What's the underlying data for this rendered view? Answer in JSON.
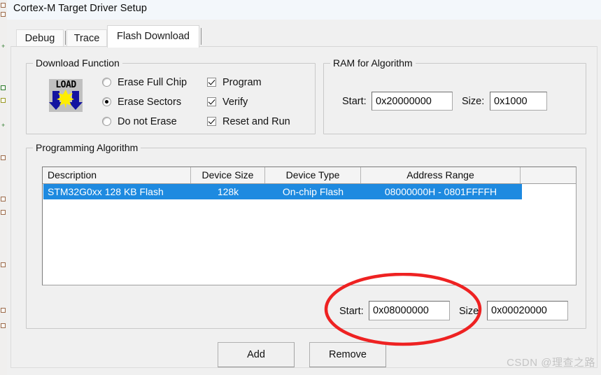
{
  "window": {
    "title": "Cortex-M Target Driver Setup"
  },
  "tabs": [
    {
      "label": "Debug",
      "active": false
    },
    {
      "label": "Trace",
      "active": false
    },
    {
      "label": "Flash Download",
      "active": true
    }
  ],
  "download_function": {
    "group_title": "Download Function",
    "icon_name": "load-icon",
    "icon_text": "LOAD",
    "radios": [
      {
        "label": "Erase Full Chip",
        "checked": false
      },
      {
        "label": "Erase Sectors",
        "checked": true
      },
      {
        "label": "Do not Erase",
        "checked": false
      }
    ],
    "checkboxes": [
      {
        "label": "Program",
        "checked": true
      },
      {
        "label": "Verify",
        "checked": true
      },
      {
        "label": "Reset and Run",
        "checked": true
      }
    ]
  },
  "ram_for_algorithm": {
    "group_title": "RAM for Algorithm",
    "start_label": "Start:",
    "start_value": "0x20000000",
    "size_label": "Size:",
    "size_value": "0x1000"
  },
  "programming_algorithm": {
    "group_title": "Programming Algorithm",
    "columns": [
      "Description",
      "Device Size",
      "Device Type",
      "Address Range",
      ""
    ],
    "rows": [
      {
        "description": "STM32G0xx 128 KB Flash",
        "device_size": "128k",
        "device_type": "On-chip Flash",
        "address_range": "08000000H - 0801FFFFH",
        "selected": true
      }
    ],
    "start_label": "Start:",
    "start_value": "0x08000000",
    "size_label": "Size:",
    "size_value": "0x00020000"
  },
  "buttons": {
    "add": "Add",
    "remove": "Remove"
  },
  "annotation": {
    "shape": "ellipse",
    "color": "#ee2222"
  },
  "watermark": {
    "text": "CSDN @理查之路"
  },
  "colors": {
    "selection_blue": "#1e8ae0",
    "dialog_bg": "#f0f0f0",
    "titlebar_bg": "#f3f7fb",
    "annotation_red": "#ee2222"
  }
}
